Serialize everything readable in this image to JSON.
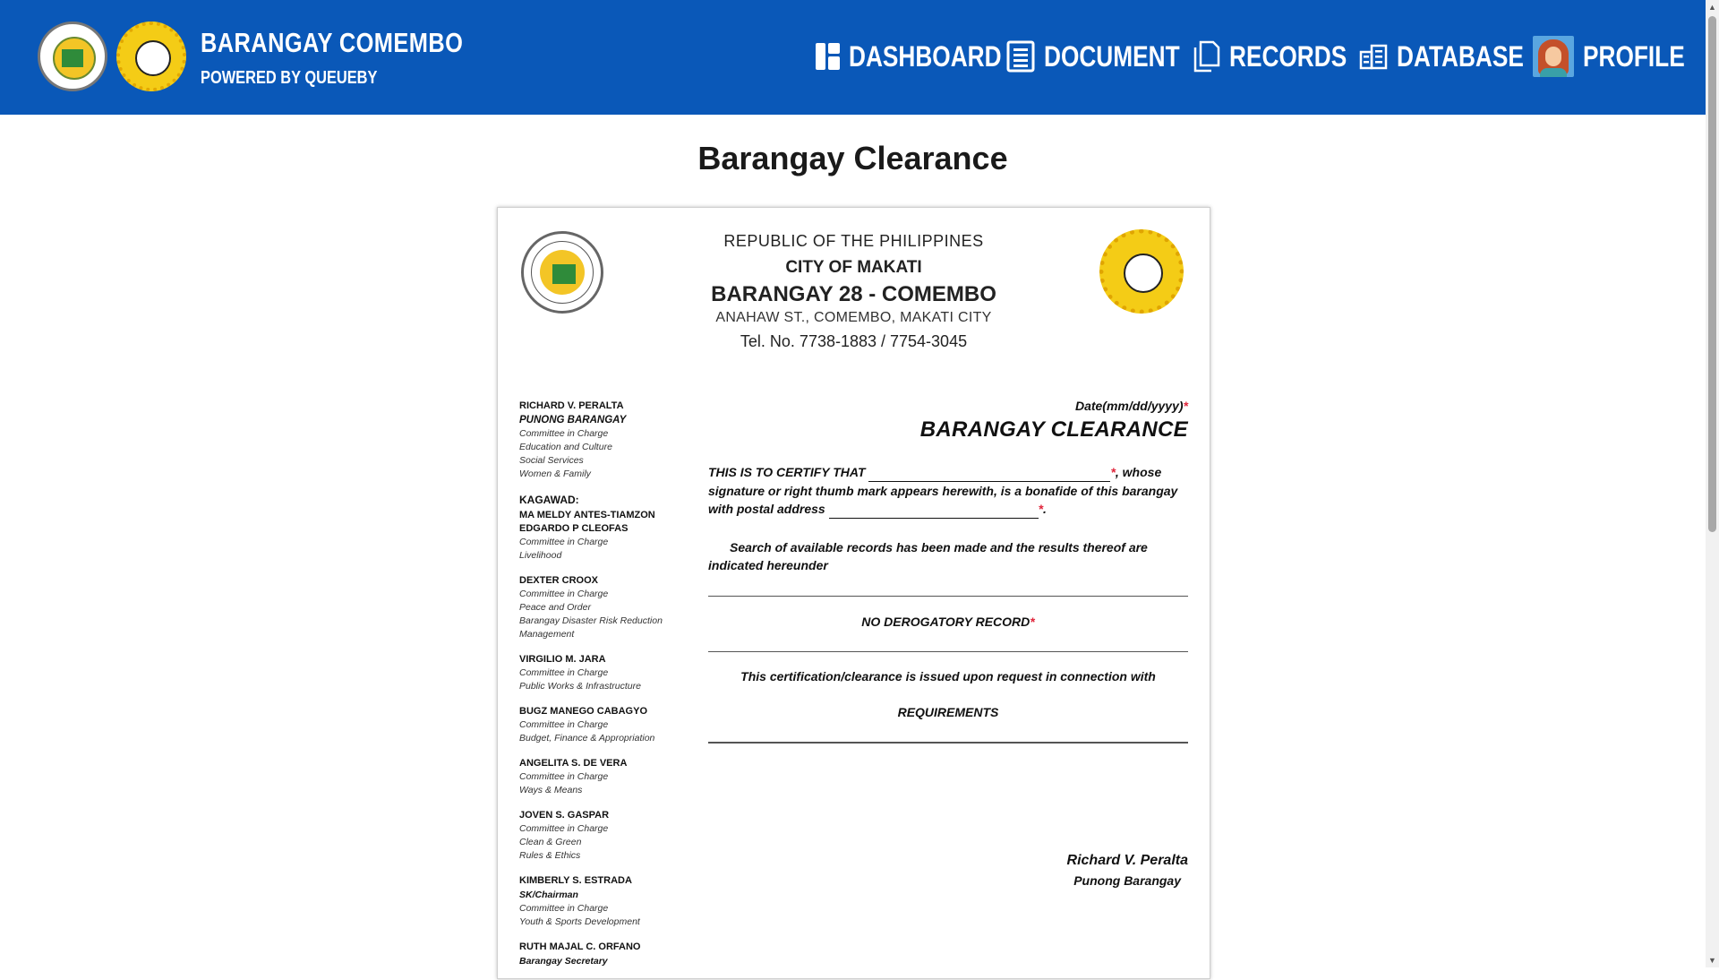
{
  "header": {
    "brand_title": "BARANGAY COMEMBO",
    "brand_subtitle": "POWERED BY QUEUEBY",
    "nav": [
      {
        "label": "DASHBOARD",
        "icon": "dashboard-icon"
      },
      {
        "label": "DOCUMENT",
        "icon": "document-icon"
      },
      {
        "label": "RECORDS",
        "icon": "records-icon"
      },
      {
        "label": "DATABASE",
        "icon": "database-icon"
      },
      {
        "label": "PROFILE",
        "icon": "avatar"
      }
    ]
  },
  "page": {
    "title": "Barangay Clearance"
  },
  "document": {
    "header": {
      "republic": "REPUBLIC OF THE PHILIPPINES",
      "city": "CITY OF MAKATI",
      "barangay": "BARANGAY 28 - COMEMBO",
      "address": "ANAHAW ST., COMEMBO, MAKATI CITY",
      "tel": "Tel. No. 7738-1883 / 7754-3045"
    },
    "officials": {
      "captain": {
        "name": "RICHARD V. PERALTA",
        "position": "PUNONG BARANGAY",
        "lines": [
          "Committee in Charge",
          "Education and Culture",
          "Social Services",
          "Women & Family"
        ]
      },
      "kagawad_label": "KAGAWAD:",
      "kagawad": [
        {
          "names": [
            "MA MELDY ANTES-TIAMZON",
            "EDGARDO P CLEOFAS"
          ],
          "lines": [
            "Committee in Charge",
            "Livelihood"
          ]
        },
        {
          "names": [
            "DEXTER CROOX"
          ],
          "lines": [
            "Committee in Charge",
            "Peace and Order",
            "Barangay Disaster Risk Reduction",
            "Management"
          ]
        },
        {
          "names": [
            "VIRGILIO M. JARA"
          ],
          "lines": [
            "Committee in Charge",
            "Public Works & Infrastructure"
          ]
        },
        {
          "names": [
            "BUGZ MANEGO CABAGYO"
          ],
          "lines": [
            "Committee in Charge",
            "Budget, Finance & Appropriation"
          ]
        },
        {
          "names": [
            "ANGELITA S. DE VERA"
          ],
          "lines": [
            "Committee in Charge",
            "Ways & Means"
          ]
        },
        {
          "names": [
            "JOVEN S. GASPAR"
          ],
          "lines": [
            "Committee in Charge",
            "Clean & Green",
            "Rules & Ethics"
          ]
        }
      ],
      "sk": {
        "name": "KIMBERLY S. ESTRADA",
        "position": "SK/Chairman",
        "lines": [
          "Committee in Charge",
          "Youth & Sports Development"
        ]
      },
      "secretary": {
        "name": "RUTH MAJAL C. ORFANO",
        "position": "Barangay Secretary"
      }
    },
    "date_label": "Date(mm/dd/yyyy)",
    "required_mark": "*",
    "clearance_title": "BARANGAY CLEARANCE",
    "certify_prefix": "THIS IS TO CERTIFY THAT",
    "certify_mid": ", whose signature or right thumb mark appears herewith, is a bonafide of this barangay with postal address",
    "certify_end": ".",
    "search_text": "Search of available records has been made and the results thereof are indicated hereunder",
    "record_status": "NO DEROGATORY RECORD",
    "purpose_text": "This certification/clearance is issued upon request in connection with",
    "requirements": "REQUIREMENTS",
    "signatory_name": "Richard V. Peralta",
    "signatory_position": "Punong Barangay"
  },
  "colors": {
    "nav_bg": "#0a58b8",
    "required": "#e0243a"
  }
}
